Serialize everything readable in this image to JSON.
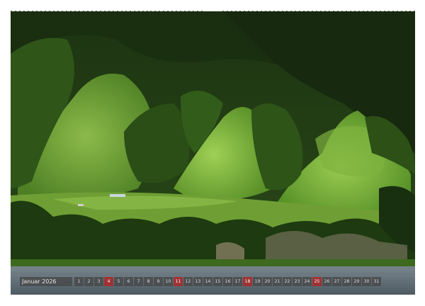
{
  "calendar": {
    "month": "Januar 2026",
    "days": [
      "1",
      "2",
      "3",
      "4",
      "5",
      "6",
      "7",
      "8",
      "9",
      "10",
      "11",
      "12",
      "13",
      "14",
      "15",
      "16",
      "17",
      "18",
      "19",
      "20",
      "21",
      "22",
      "23",
      "24",
      "25",
      "26",
      "27",
      "28",
      "29",
      "30",
      "31"
    ],
    "sundays": [
      4,
      11,
      18,
      25
    ]
  },
  "colors": {
    "sunday": "#aa2828",
    "grid_cell": "#464646",
    "lake": "#5f6e78"
  }
}
